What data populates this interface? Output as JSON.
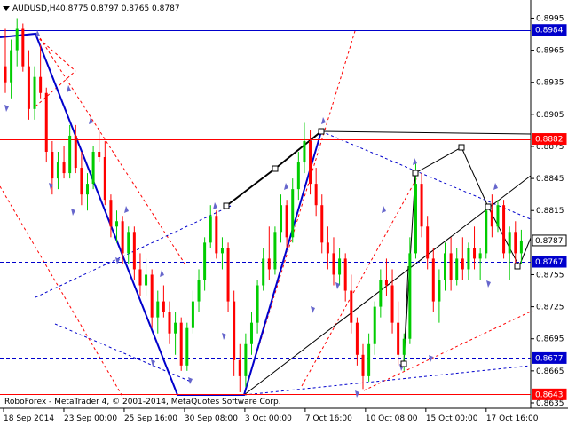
{
  "header": {
    "symbol": "AUDUSD,H4",
    "ohlc": "0.8775 0.8797 0.8765 0.8787"
  },
  "footer": {
    "copyright": "RoboForex - MetaTrader 4, © 2001-2014, MetaQuotes Software Corp."
  },
  "colors": {
    "background": "#ffffff",
    "bull": "#00cc00",
    "bear": "#ff0000",
    "trendline": "#0000cc",
    "resistance": "#0000cc",
    "support_line": "#ff0000",
    "channel": "#ff0000",
    "channel_blue": "#0000cc",
    "tag_blue": "#0000cc",
    "tag_red": "#ff0000"
  },
  "chart_data": {
    "type": "candlestick",
    "title": "AUDUSD,H4",
    "y_ticks": [
      "0.8995",
      "0.8965",
      "0.8935",
      "0.8905",
      "0.8875",
      "0.8845",
      "0.8815",
      "0.8755",
      "0.8725",
      "0.8695",
      "0.8665",
      "0.8635"
    ],
    "x_ticks": [
      "18 Sep 2014",
      "23 Sep 00:00",
      "25 Sep 16:00",
      "30 Sep 08:00",
      "3 Oct 00:00",
      "7 Oct 16:00",
      "10 Oct 08:00",
      "15 Oct 00:00",
      "17 Oct 16:00"
    ],
    "ylim": [
      0.863,
      0.9012
    ],
    "price_tags": [
      {
        "label": "0.8984",
        "value": 0.8984,
        "color": "blue"
      },
      {
        "label": "0.8882",
        "value": 0.8882,
        "color": "red"
      },
      {
        "label": "0.8787",
        "value": 0.8787,
        "color": "white"
      },
      {
        "label": "0.8767",
        "value": 0.8767,
        "color": "blue"
      },
      {
        "label": "0.8677",
        "value": 0.8677,
        "color": "blue"
      },
      {
        "label": "0.8643",
        "value": 0.8643,
        "color": "red"
      }
    ],
    "horizontal_lines": [
      {
        "value": 0.8984,
        "style": "solid",
        "color": "blue"
      },
      {
        "value": 0.8882,
        "style": "solid",
        "color": "red"
      },
      {
        "value": 0.8767,
        "style": "dashed",
        "color": "blue"
      },
      {
        "value": 0.8677,
        "style": "dashed",
        "color": "blue"
      },
      {
        "value": 0.8643,
        "style": "solid",
        "color": "red"
      }
    ],
    "candles": [
      [
        0.895,
        0.8985,
        0.8925,
        0.8935
      ],
      [
        0.8935,
        0.8975,
        0.892,
        0.8965
      ],
      [
        0.8965,
        0.8995,
        0.895,
        0.8985
      ],
      [
        0.8985,
        0.899,
        0.8945,
        0.895
      ],
      [
        0.895,
        0.8965,
        0.89,
        0.891
      ],
      [
        0.891,
        0.895,
        0.89,
        0.894
      ],
      [
        0.894,
        0.897,
        0.892,
        0.8925
      ],
      [
        0.8925,
        0.893,
        0.886,
        0.887
      ],
      [
        0.887,
        0.888,
        0.883,
        0.8845
      ],
      [
        0.8845,
        0.887,
        0.8835,
        0.886
      ],
      [
        0.886,
        0.8875,
        0.8845,
        0.885
      ],
      [
        0.885,
        0.8895,
        0.8845,
        0.8885
      ],
      [
        0.8885,
        0.8895,
        0.885,
        0.8855
      ],
      [
        0.8855,
        0.887,
        0.882,
        0.883
      ],
      [
        0.883,
        0.885,
        0.8815,
        0.884
      ],
      [
        0.884,
        0.8875,
        0.8835,
        0.887
      ],
      [
        0.887,
        0.889,
        0.886,
        0.8865
      ],
      [
        0.8865,
        0.888,
        0.882,
        0.8825
      ],
      [
        0.8825,
        0.883,
        0.879,
        0.88
      ],
      [
        0.88,
        0.8815,
        0.8785,
        0.8805
      ],
      [
        0.8805,
        0.881,
        0.8765,
        0.8775
      ],
      [
        0.8775,
        0.88,
        0.8765,
        0.8795
      ],
      [
        0.8795,
        0.88,
        0.875,
        0.876
      ],
      [
        0.876,
        0.8775,
        0.8735,
        0.8745
      ],
      [
        0.8745,
        0.877,
        0.8735,
        0.8755
      ],
      [
        0.8755,
        0.876,
        0.8705,
        0.8715
      ],
      [
        0.8715,
        0.874,
        0.87,
        0.873
      ],
      [
        0.873,
        0.8745,
        0.8715,
        0.872
      ],
      [
        0.872,
        0.873,
        0.869,
        0.87
      ],
      [
        0.87,
        0.872,
        0.868,
        0.871
      ],
      [
        0.871,
        0.8715,
        0.8665,
        0.867
      ],
      [
        0.867,
        0.871,
        0.8665,
        0.8705
      ],
      [
        0.8705,
        0.874,
        0.87,
        0.873
      ],
      [
        0.873,
        0.876,
        0.872,
        0.875
      ],
      [
        0.875,
        0.879,
        0.874,
        0.8785
      ],
      [
        0.8785,
        0.882,
        0.878,
        0.881
      ],
      [
        0.881,
        0.8815,
        0.877,
        0.8775
      ],
      [
        0.8775,
        0.879,
        0.876,
        0.878
      ],
      [
        0.878,
        0.8785,
        0.872,
        0.873
      ],
      [
        0.873,
        0.874,
        0.866,
        0.8675
      ],
      [
        0.8675,
        0.869,
        0.8645,
        0.866
      ],
      [
        0.866,
        0.87,
        0.865,
        0.869
      ],
      [
        0.869,
        0.872,
        0.868,
        0.871
      ],
      [
        0.871,
        0.875,
        0.87,
        0.8745
      ],
      [
        0.8745,
        0.878,
        0.874,
        0.877
      ],
      [
        0.877,
        0.88,
        0.875,
        0.876
      ],
      [
        0.876,
        0.88,
        0.8755,
        0.8795
      ],
      [
        0.8795,
        0.883,
        0.8785,
        0.882
      ],
      [
        0.882,
        0.8825,
        0.878,
        0.879
      ],
      [
        0.879,
        0.8845,
        0.8785,
        0.8835
      ],
      [
        0.8835,
        0.887,
        0.8825,
        0.886
      ],
      [
        0.886,
        0.8897,
        0.885,
        0.888
      ],
      [
        0.888,
        0.889,
        0.883,
        0.884
      ],
      [
        0.884,
        0.8855,
        0.881,
        0.882
      ],
      [
        0.882,
        0.883,
        0.8775,
        0.8785
      ],
      [
        0.8785,
        0.88,
        0.876,
        0.8775
      ],
      [
        0.8775,
        0.879,
        0.8745,
        0.8755
      ],
      [
        0.8755,
        0.878,
        0.8745,
        0.877
      ],
      [
        0.877,
        0.8775,
        0.873,
        0.874
      ],
      [
        0.874,
        0.8755,
        0.87,
        0.871
      ],
      [
        0.871,
        0.8715,
        0.867,
        0.868
      ],
      [
        0.868,
        0.869,
        0.8648,
        0.866
      ],
      [
        0.866,
        0.87,
        0.8655,
        0.869
      ],
      [
        0.869,
        0.873,
        0.868,
        0.8725
      ],
      [
        0.8725,
        0.876,
        0.8715,
        0.875
      ],
      [
        0.875,
        0.877,
        0.8735,
        0.8745
      ],
      [
        0.8745,
        0.876,
        0.87,
        0.871
      ],
      [
        0.871,
        0.873,
        0.867,
        0.868
      ],
      [
        0.868,
        0.87,
        0.8665,
        0.8695
      ],
      [
        0.8695,
        0.879,
        0.869,
        0.8775
      ],
      [
        0.8775,
        0.886,
        0.877,
        0.884
      ],
      [
        0.884,
        0.885,
        0.879,
        0.88
      ],
      [
        0.88,
        0.881,
        0.876,
        0.877
      ],
      [
        0.877,
        0.878,
        0.872,
        0.873
      ],
      [
        0.873,
        0.876,
        0.871,
        0.875
      ],
      [
        0.875,
        0.8785,
        0.874,
        0.8775
      ],
      [
        0.8775,
        0.879,
        0.874,
        0.875
      ],
      [
        0.875,
        0.878,
        0.8745,
        0.877
      ],
      [
        0.877,
        0.879,
        0.875,
        0.876
      ],
      [
        0.876,
        0.8785,
        0.875,
        0.878
      ],
      [
        0.878,
        0.88,
        0.876,
        0.877
      ],
      [
        0.877,
        0.878,
        0.875,
        0.8775
      ],
      [
        0.8775,
        0.882,
        0.877,
        0.8815
      ],
      [
        0.8815,
        0.883,
        0.879,
        0.88
      ],
      [
        0.88,
        0.8825,
        0.8795,
        0.882
      ],
      [
        0.882,
        0.8825,
        0.877,
        0.8775
      ],
      [
        0.8775,
        0.88,
        0.875,
        0.8795
      ],
      [
        0.8795,
        0.8805,
        0.8765,
        0.8775
      ],
      [
        0.8775,
        0.8797,
        0.8765,
        0.8787
      ]
    ]
  }
}
